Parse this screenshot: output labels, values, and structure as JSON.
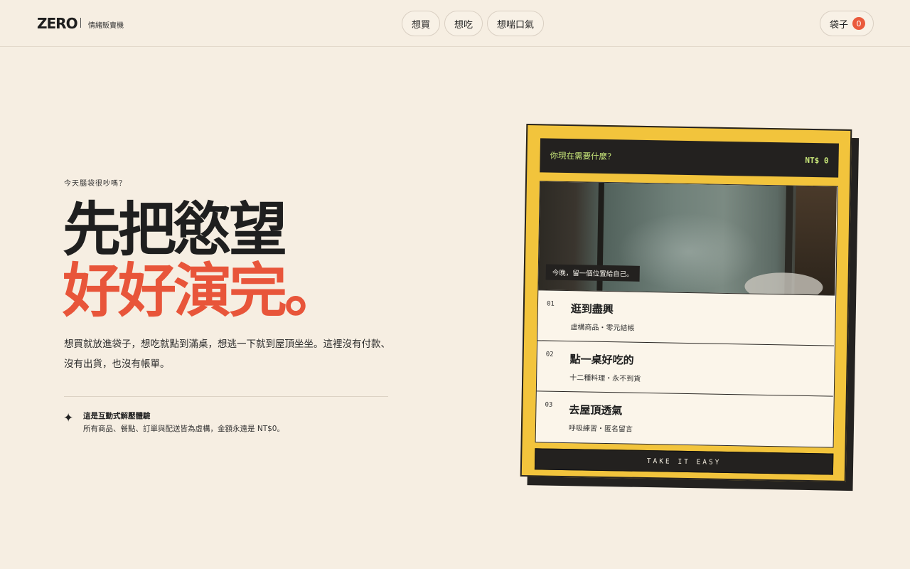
{
  "header": {
    "logo": "ZERO",
    "subtitle": "情緒販賣機",
    "nav": [
      "想買",
      "想吃",
      "想喘口氣"
    ],
    "bag_label": "袋子",
    "bag_count": "0",
    "accent": "#ea5a3c"
  },
  "hero": {
    "eyebrow": "今天腦袋很吵嗎？",
    "headline_line1": "先把慾望",
    "headline_line2": "好好演完。",
    "description": "想買就放進袋子，想吃就點到滿桌，想逃一下就到屋頂坐坐。這裡沒有付款、沒有出貨，也沒有帳單。",
    "note_icon": "sparkle-icon",
    "note_title": "這是互動式解壓體驗",
    "note_text": "所有商品、餐點、訂單與配送皆為虛構，金額永遠是 NT$0。",
    "headline_color": "#1f1f1f",
    "highlight_color": "#e8553a"
  },
  "card": {
    "prompt": "你現在需要什麼？",
    "total": "NT$ 0",
    "photo_caption": "今晚，留一個位置給自己。",
    "items": [
      {
        "num": "01",
        "title": "逛到盡興",
        "sub": "虛構商品・零元結帳"
      },
      {
        "num": "02",
        "title": "點一桌好吃的",
        "sub": "十二種料理・永不到貨"
      },
      {
        "num": "03",
        "title": "去屋頂透氣",
        "sub": "呼吸練習・匿名留言"
      }
    ],
    "button_label": "TAKE IT EASY",
    "card_color": "#f2c43c",
    "dark_color": "#23211f"
  }
}
